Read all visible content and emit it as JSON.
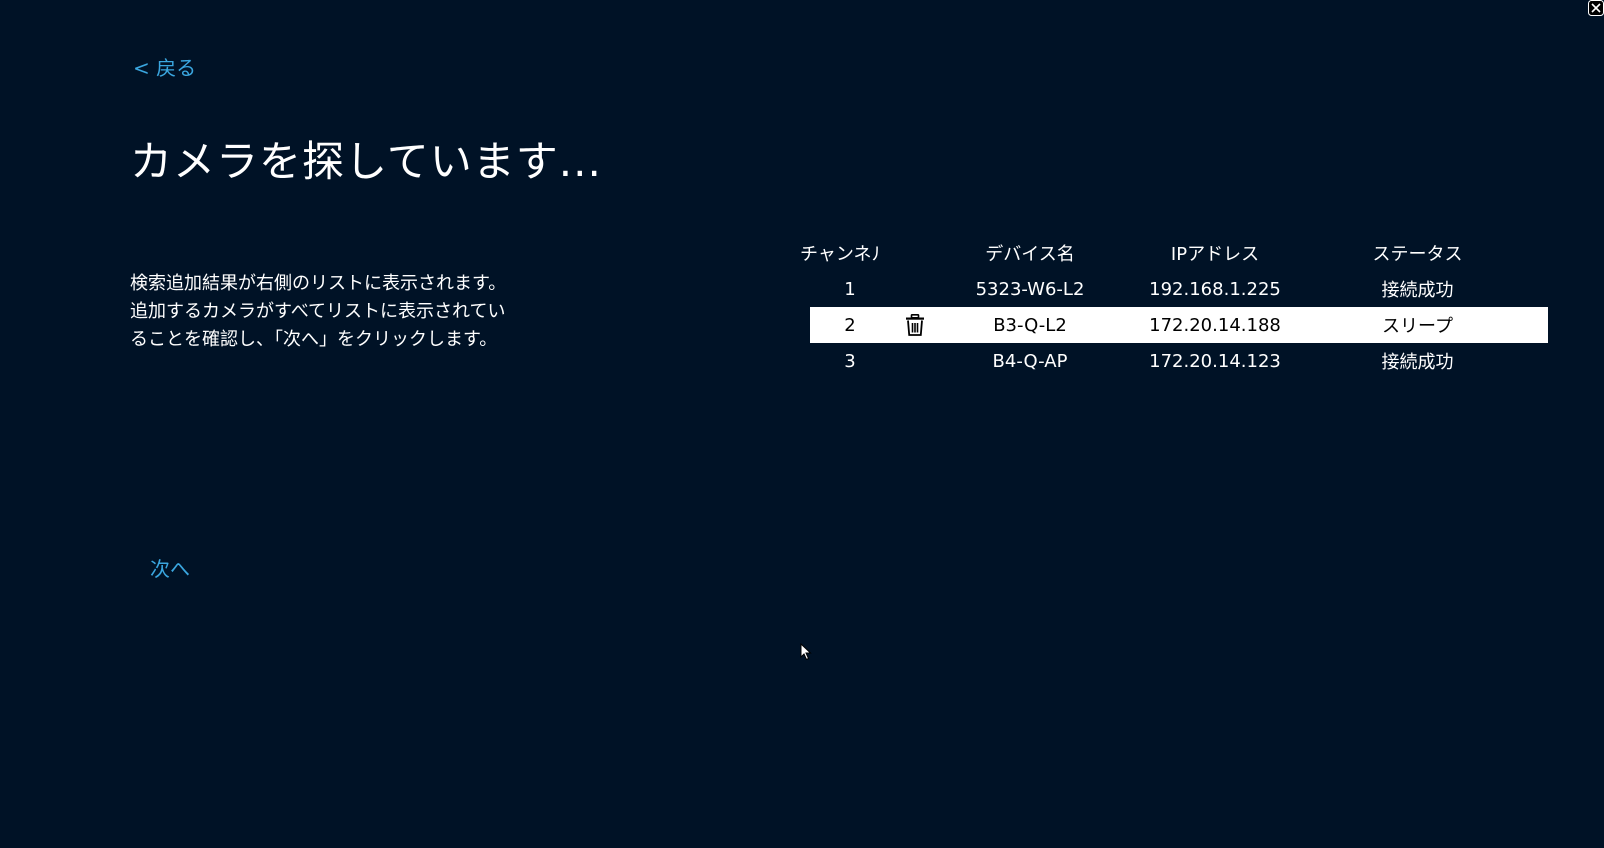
{
  "nav": {
    "back_label": "< 戻る",
    "next_label": "次へ"
  },
  "page": {
    "title": "カメラを探しています...",
    "description": [
      "検索追加結果が右側のリストに表示されます。",
      "追加するカメラがすべてリストに表示されてい",
      "ることを確認し、「次へ」をクリックします。"
    ]
  },
  "table": {
    "headers": {
      "channel": "チャンネル",
      "device_name": "デバイス名",
      "ip_address": "IPアドレス",
      "status": "ステータス"
    },
    "rows": [
      {
        "channel": "1",
        "device_name": "5323-W6-L2",
        "ip_address": "192.168.1.225",
        "status": "接続成功"
      },
      {
        "channel": "2",
        "device_name": "B3-Q-L2",
        "ip_address": "172.20.14.188",
        "status": "スリープ",
        "selected": true
      },
      {
        "channel": "3",
        "device_name": "B4-Q-AP",
        "ip_address": "172.20.14.123",
        "status": "接続成功"
      }
    ]
  },
  "icons": {
    "delete": "trash-icon",
    "close": "close-icon",
    "cursor": "mouse-cursor-icon"
  },
  "colors": {
    "background": "#001226",
    "accent": "#3aa6df",
    "text": "#ffffff",
    "selected_row_bg": "#ffffff",
    "selected_row_text": "#000000"
  }
}
